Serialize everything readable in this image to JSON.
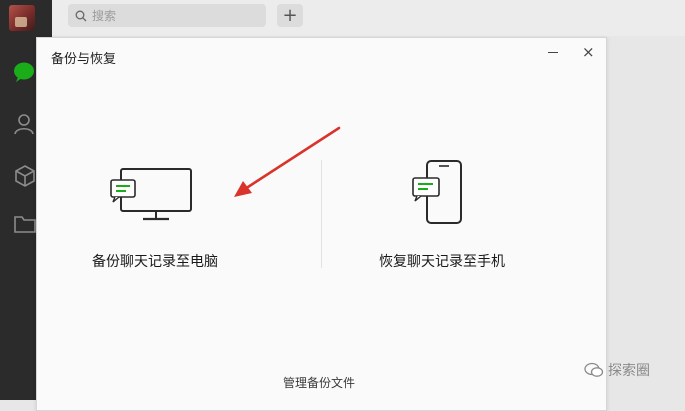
{
  "search": {
    "placeholder": "搜索"
  },
  "topbar": {
    "add_label": "+"
  },
  "dialog": {
    "title": "备份与恢复",
    "minimize_label": "",
    "close_label": "×",
    "options": [
      {
        "label": "备份聊天记录至电脑",
        "icon": "monitor-chat-icon"
      },
      {
        "label": "恢复聊天记录至手机",
        "icon": "phone-chat-icon"
      }
    ],
    "manage_link": "管理备份文件"
  },
  "sidebar": {
    "icons": [
      "chat-icon",
      "contacts-icon",
      "cube-icon",
      "folder-icon"
    ]
  },
  "watermark": {
    "text": "探索圈"
  },
  "colors": {
    "accent": "#1aad19",
    "annotation_arrow": "#d9342b",
    "sidebar": "#2b2b2b"
  }
}
